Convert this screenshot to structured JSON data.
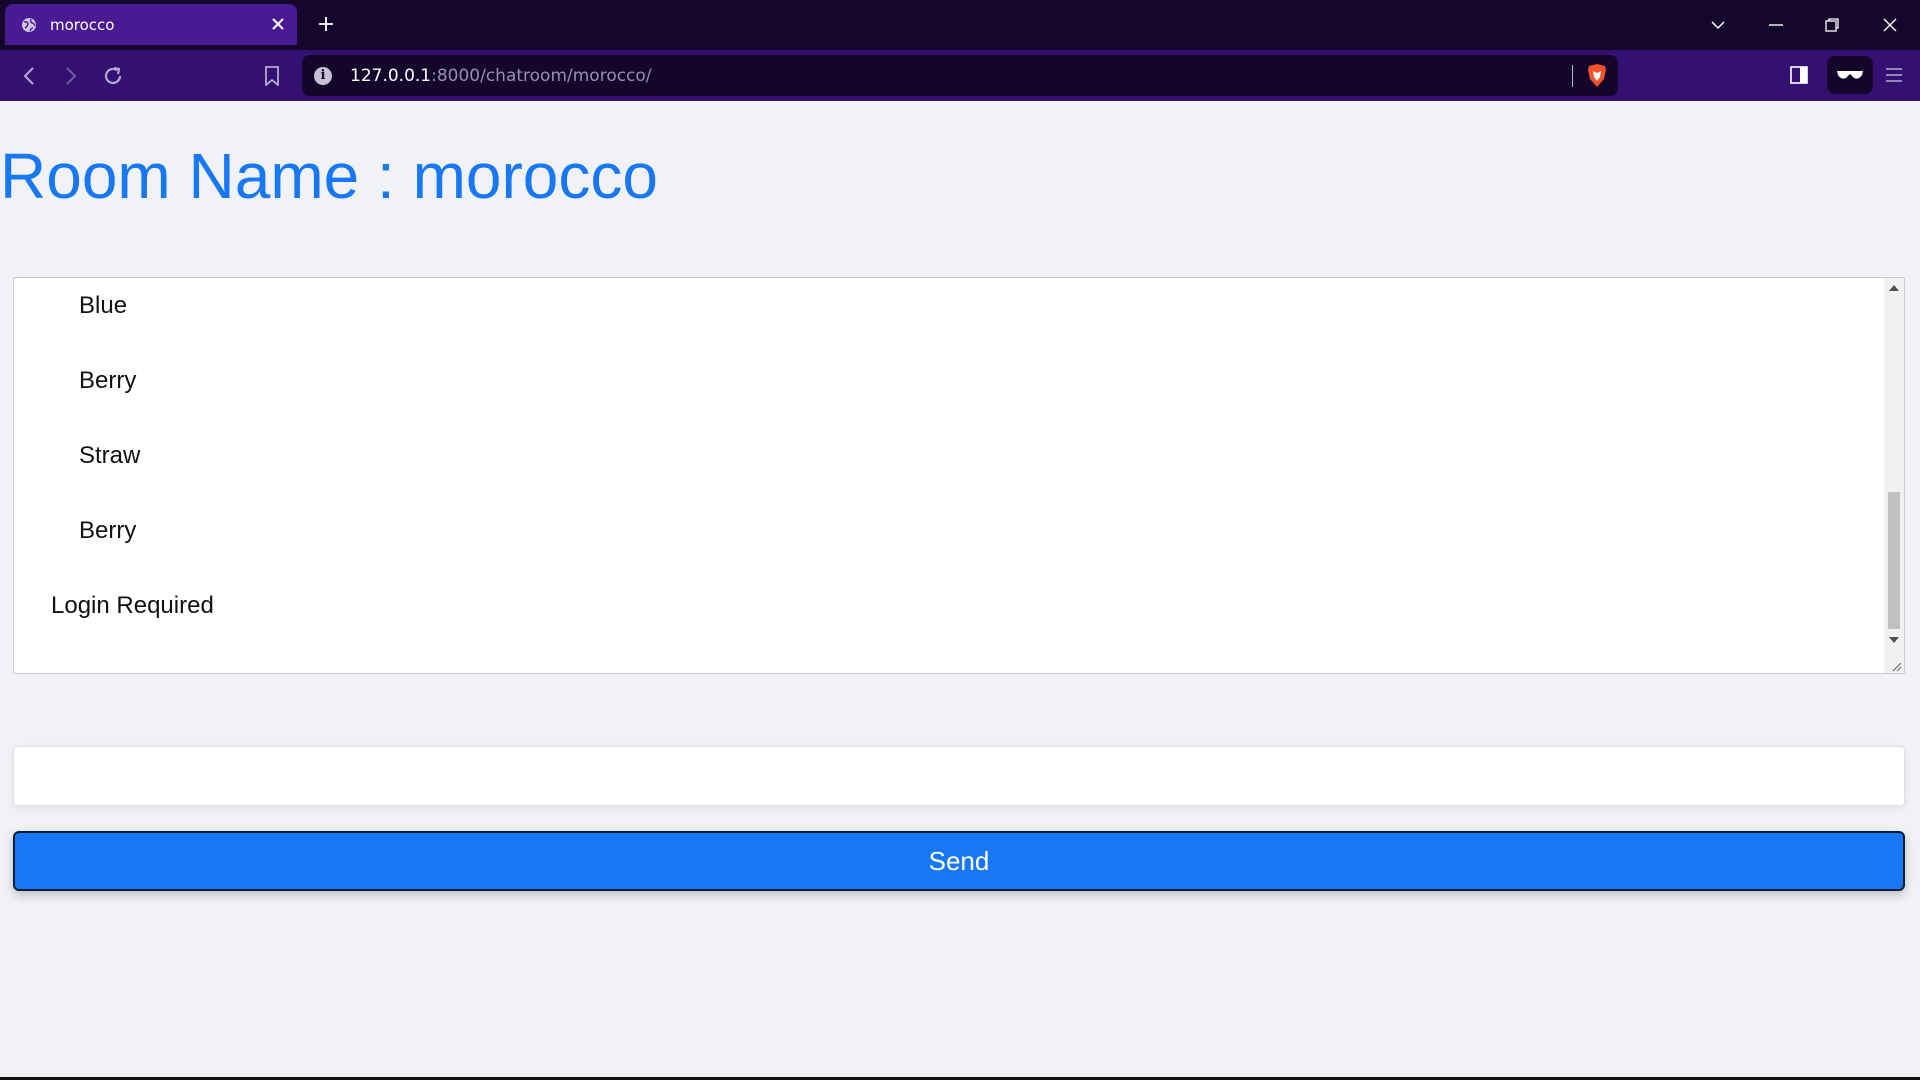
{
  "browser": {
    "tab": {
      "title": "morocco",
      "favicon": "globe-icon"
    },
    "url": {
      "host": "127.0.0.1",
      "rest": ":8000/chatroom/morocco/"
    },
    "icons": {
      "back": "chevron-left-icon",
      "forward": "chevron-right-icon",
      "reload": "reload-icon",
      "bookmark": "bookmark-icon",
      "site_info": "info-icon",
      "shield": "brave-shield-icon",
      "sidebar": "sidebar-icon",
      "wallet": "wallet-icon",
      "menu": "hamburger-menu-icon"
    },
    "colors": {
      "tabbar": "#15062b",
      "active_tab": "#4a1a93",
      "toolbar": "#341070",
      "urlbar": "#14052b"
    }
  },
  "page": {
    "title": "Room Name : morocco",
    "messages": [
      {
        "text": "Blue"
      },
      {
        "text": "Berry"
      },
      {
        "text": "Straw"
      },
      {
        "text": "Berry"
      },
      {
        "text": "Login Required"
      }
    ],
    "input": {
      "value": "",
      "placeholder": ""
    },
    "send_label": "Send",
    "colors": {
      "accent": "#1877f2",
      "background": "#f0f2f5"
    }
  }
}
